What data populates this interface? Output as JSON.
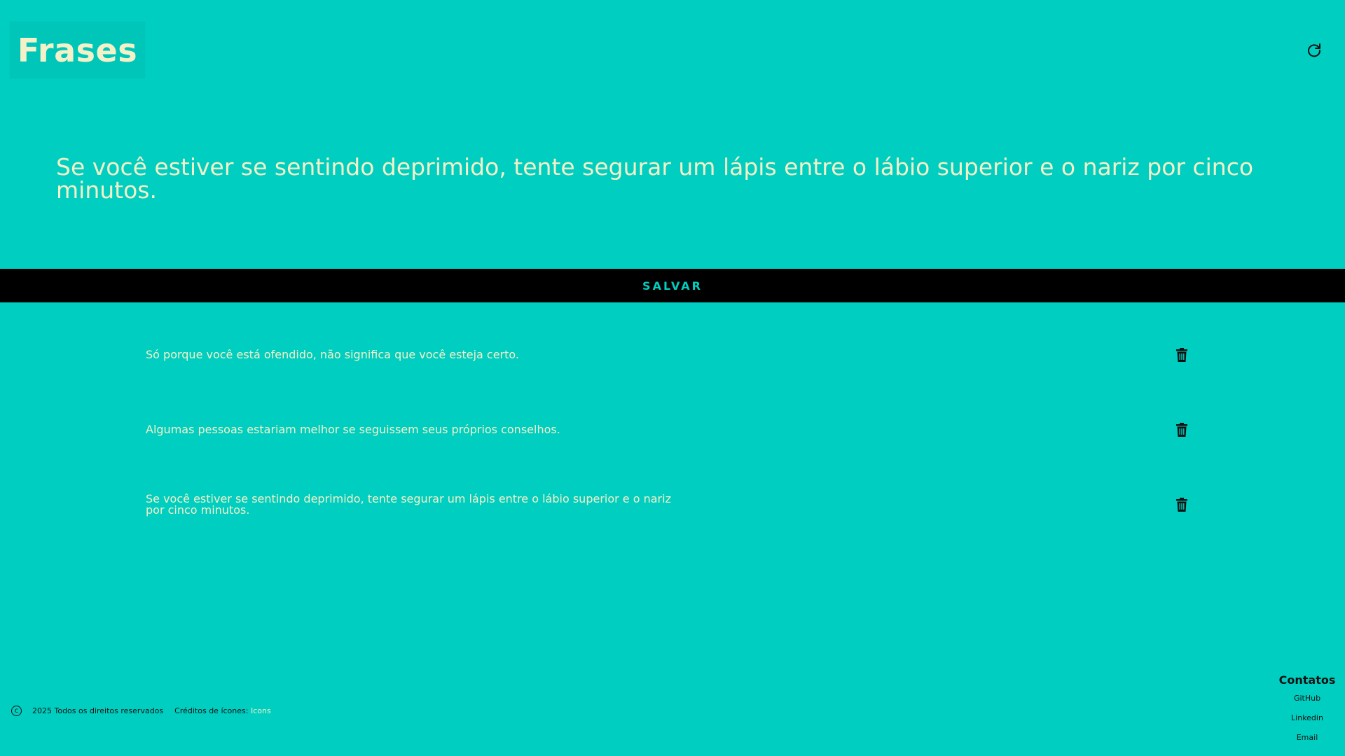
{
  "header": {
    "logo_text": "Frases",
    "refresh_icon": "refresh-icon"
  },
  "current_quote": {
    "text": "Se você estiver se sentindo deprimido, tente segurar um lápis entre o lábio superior e o nariz por cinco minutos."
  },
  "save_button": {
    "label": "SALVAR"
  },
  "saved_quotes": [
    {
      "text": "Só porque você está ofendido, não significa que você esteja certo.",
      "delete_icon": "trash-icon"
    },
    {
      "text": "Algumas pessoas estariam melhor se seguissem seus próprios conselhos.",
      "delete_icon": "trash-icon"
    },
    {
      "text": "Se você estiver se sentindo deprimido, tente segurar um lápis entre o lábio superior e o nariz por cinco minutos.",
      "delete_icon": "trash-icon"
    }
  ],
  "footer": {
    "copyright_icon": "copyright-icon",
    "copyright_text": "2025 Todos os direitos reservados",
    "credits_label": "Créditos de ícones:",
    "credits_link": "Icons",
    "contacts": {
      "title": "Contatos",
      "links": [
        "GitHub",
        "Linkedin",
        "Email"
      ]
    }
  },
  "colors": {
    "background": "#00cec0",
    "text_light": "#f4f1c9",
    "bar": "#000000"
  }
}
